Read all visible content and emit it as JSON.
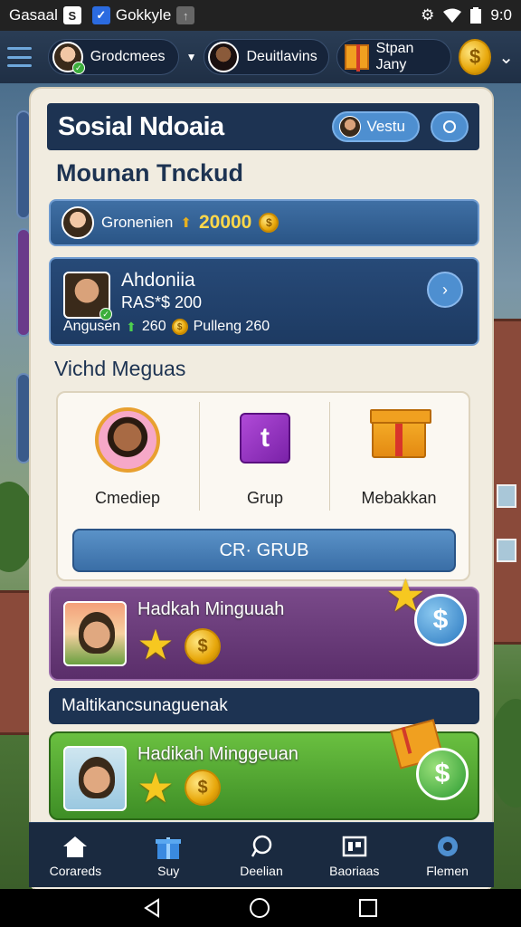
{
  "status_bar": {
    "carrier": "Gasaal",
    "app_icon_1": "S",
    "app_label": "Gokkyle",
    "time": "9:0"
  },
  "top_nav": {
    "player_1": "Grodcmees",
    "player_2": "Deuitlavins",
    "shop": "Stpan Jany",
    "coin_symbol": "$"
  },
  "panel": {
    "title": "Sosial Ndoaia",
    "visit_button": "Vestu",
    "subtitle": "Mounan Tnckud",
    "balance": {
      "name": "Gronenien",
      "amount": "20000",
      "coin_symbol": "$"
    },
    "friend": {
      "name": "Ahdoniia",
      "sub": "RAS*$ 200",
      "stat_label": "Angusen",
      "stat_value": "260",
      "extra_label": "Pulleng 260",
      "coin_symbol": "$"
    },
    "section_title": "Vichd Meguas",
    "options": [
      {
        "label": "Cmediep",
        "icon": "avatar-icon"
      },
      {
        "label": "Grup",
        "icon": "cube-icon",
        "glyph": "t"
      },
      {
        "label": "Mebakkan",
        "icon": "gift-icon"
      }
    ],
    "group_button": "CR· GRUB",
    "promo_1": {
      "title": "Hadkah Minguuah",
      "coin_symbol": "$",
      "badge_symbol": "$"
    },
    "mid_bar": "Maltikancsunaguenak",
    "promo_2": {
      "title": "Hadikah Minggeuan",
      "coin_symbol": "$",
      "badge_symbol": "$"
    }
  },
  "tabs": [
    {
      "label": "Corareds",
      "icon": "home-icon"
    },
    {
      "label": "Suy",
      "icon": "gift-icon"
    },
    {
      "label": "Deelian",
      "icon": "chat-icon"
    },
    {
      "label": "Baoriaas",
      "icon": "board-icon"
    },
    {
      "label": "Flemen",
      "icon": "settings-icon"
    }
  ],
  "colors": {
    "panel_bg": "#f1ece0",
    "title_bar": "#1d3352",
    "accent_blue": "#4e8fd0",
    "gold": "#ffd84a",
    "promo_purple": "#6a3a7a",
    "promo_green": "#52a834"
  }
}
